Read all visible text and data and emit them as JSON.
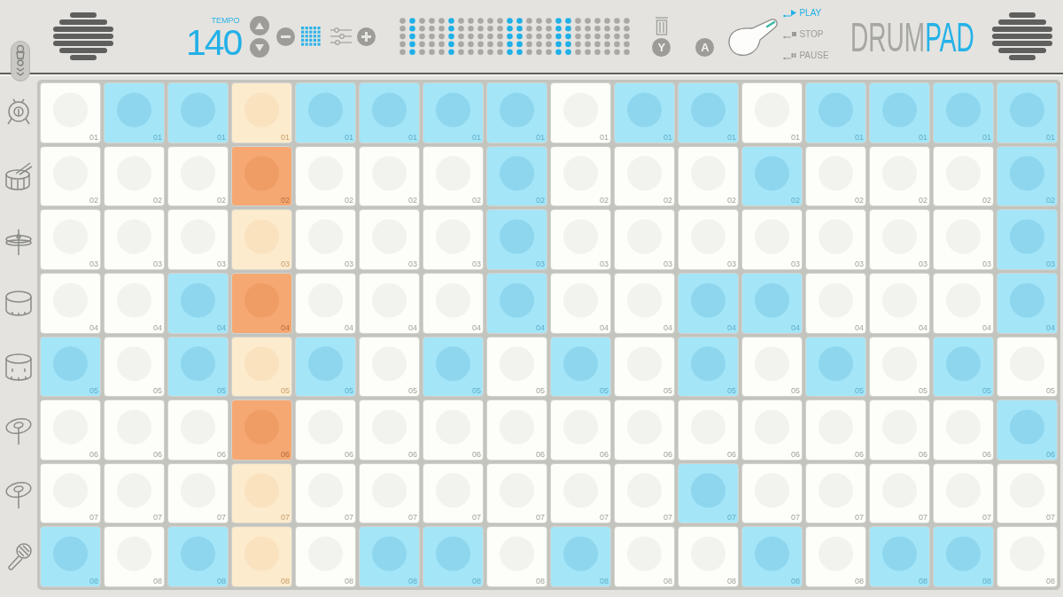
{
  "header": {
    "tempo": {
      "label": "TEMPO",
      "value": "140"
    },
    "key_hints": [
      {
        "kind": "trash",
        "key": "Y"
      },
      {
        "kind": "plain",
        "key": "A"
      }
    ],
    "transport": [
      {
        "kind": "play",
        "label": "PLAY",
        "selected": true
      },
      {
        "kind": "stop",
        "label": "STOP",
        "selected": false
      },
      {
        "kind": "pause",
        "label": "PAUSE",
        "selected": false
      }
    ],
    "logo": {
      "text": "DRUM",
      "accent": "PAD"
    }
  },
  "pattern": {
    "columns": [
      {
        "playing": false
      },
      {
        "playing": false
      },
      {
        "playing": false
      },
      {
        "playing": true
      },
      {
        "playing": false
      },
      {
        "playing": false
      },
      {
        "playing": false
      },
      {
        "playing": false
      },
      {
        "playing": false
      },
      {
        "playing": false
      },
      {
        "playing": false
      },
      {
        "playing": false
      },
      {
        "playing": false
      },
      {
        "playing": false
      },
      {
        "playing": false
      },
      {
        "playing": false
      }
    ],
    "tracks": [
      {
        "steps": [
          {
            "label": "01",
            "on": false
          },
          {
            "label": "01",
            "on": true
          },
          {
            "label": "01",
            "on": true
          },
          {
            "label": "01",
            "on": false
          },
          {
            "label": "01",
            "on": true
          },
          {
            "label": "01",
            "on": true
          },
          {
            "label": "01",
            "on": true
          },
          {
            "label": "01",
            "on": true
          },
          {
            "label": "01",
            "on": false
          },
          {
            "label": "01",
            "on": true
          },
          {
            "label": "01",
            "on": true
          },
          {
            "label": "01",
            "on": false
          },
          {
            "label": "01",
            "on": true
          },
          {
            "label": "01",
            "on": true
          },
          {
            "label": "01",
            "on": true
          },
          {
            "label": "01",
            "on": true
          }
        ]
      },
      {
        "steps": [
          {
            "label": "02",
            "on": false
          },
          {
            "label": "02",
            "on": false
          },
          {
            "label": "02",
            "on": false
          },
          {
            "label": "02",
            "on": true
          },
          {
            "label": "02",
            "on": false
          },
          {
            "label": "02",
            "on": false
          },
          {
            "label": "02",
            "on": false
          },
          {
            "label": "02",
            "on": true
          },
          {
            "label": "02",
            "on": false
          },
          {
            "label": "02",
            "on": false
          },
          {
            "label": "02",
            "on": false
          },
          {
            "label": "02",
            "on": true
          },
          {
            "label": "02",
            "on": false
          },
          {
            "label": "02",
            "on": false
          },
          {
            "label": "02",
            "on": false
          },
          {
            "label": "02",
            "on": true
          }
        ]
      },
      {
        "steps": [
          {
            "label": "03",
            "on": false
          },
          {
            "label": "03",
            "on": false
          },
          {
            "label": "03",
            "on": false
          },
          {
            "label": "03",
            "on": false
          },
          {
            "label": "03",
            "on": false
          },
          {
            "label": "03",
            "on": false
          },
          {
            "label": "03",
            "on": false
          },
          {
            "label": "03",
            "on": true
          },
          {
            "label": "03",
            "on": false
          },
          {
            "label": "03",
            "on": false
          },
          {
            "label": "03",
            "on": false
          },
          {
            "label": "03",
            "on": false
          },
          {
            "label": "03",
            "on": false
          },
          {
            "label": "03",
            "on": false
          },
          {
            "label": "03",
            "on": false
          },
          {
            "label": "03",
            "on": true
          }
        ]
      },
      {
        "steps": [
          {
            "label": "04",
            "on": false
          },
          {
            "label": "04",
            "on": false
          },
          {
            "label": "04",
            "on": true
          },
          {
            "label": "04",
            "on": true
          },
          {
            "label": "04",
            "on": false
          },
          {
            "label": "04",
            "on": false
          },
          {
            "label": "04",
            "on": false
          },
          {
            "label": "04",
            "on": true
          },
          {
            "label": "04",
            "on": false
          },
          {
            "label": "04",
            "on": false
          },
          {
            "label": "04",
            "on": true
          },
          {
            "label": "04",
            "on": true
          },
          {
            "label": "04",
            "on": false
          },
          {
            "label": "04",
            "on": false
          },
          {
            "label": "04",
            "on": false
          },
          {
            "label": "04",
            "on": true
          }
        ]
      },
      {
        "steps": [
          {
            "label": "05",
            "on": true
          },
          {
            "label": "05",
            "on": false
          },
          {
            "label": "05",
            "on": true
          },
          {
            "label": "05",
            "on": false
          },
          {
            "label": "05",
            "on": true
          },
          {
            "label": "05",
            "on": false
          },
          {
            "label": "05",
            "on": true
          },
          {
            "label": "05",
            "on": false
          },
          {
            "label": "05",
            "on": true
          },
          {
            "label": "05",
            "on": false
          },
          {
            "label": "05",
            "on": true
          },
          {
            "label": "05",
            "on": false
          },
          {
            "label": "05",
            "on": true
          },
          {
            "label": "05",
            "on": false
          },
          {
            "label": "05",
            "on": true
          },
          {
            "label": "05",
            "on": false
          }
        ]
      },
      {
        "steps": [
          {
            "label": "06",
            "on": false
          },
          {
            "label": "06",
            "on": false
          },
          {
            "label": "06",
            "on": false
          },
          {
            "label": "06",
            "on": true
          },
          {
            "label": "06",
            "on": false
          },
          {
            "label": "06",
            "on": false
          },
          {
            "label": "06",
            "on": false
          },
          {
            "label": "06",
            "on": false
          },
          {
            "label": "06",
            "on": false
          },
          {
            "label": "06",
            "on": false
          },
          {
            "label": "06",
            "on": false
          },
          {
            "label": "06",
            "on": false
          },
          {
            "label": "06",
            "on": false
          },
          {
            "label": "06",
            "on": false
          },
          {
            "label": "06",
            "on": false
          },
          {
            "label": "06",
            "on": true
          }
        ]
      },
      {
        "steps": [
          {
            "label": "07",
            "on": false
          },
          {
            "label": "07",
            "on": false
          },
          {
            "label": "07",
            "on": false
          },
          {
            "label": "07",
            "on": false
          },
          {
            "label": "07",
            "on": false
          },
          {
            "label": "07",
            "on": false
          },
          {
            "label": "07",
            "on": false
          },
          {
            "label": "07",
            "on": false
          },
          {
            "label": "07",
            "on": false
          },
          {
            "label": "07",
            "on": false
          },
          {
            "label": "07",
            "on": true
          },
          {
            "label": "07",
            "on": false
          },
          {
            "label": "07",
            "on": false
          },
          {
            "label": "07",
            "on": false
          },
          {
            "label": "07",
            "on": false
          },
          {
            "label": "07",
            "on": false
          }
        ]
      },
      {
        "steps": [
          {
            "label": "08",
            "on": true
          },
          {
            "label": "08",
            "on": false
          },
          {
            "label": "08",
            "on": true
          },
          {
            "label": "08",
            "on": false
          },
          {
            "label": "08",
            "on": false
          },
          {
            "label": "08",
            "on": true
          },
          {
            "label": "08",
            "on": true
          },
          {
            "label": "08",
            "on": false
          },
          {
            "label": "08",
            "on": true
          },
          {
            "label": "08",
            "on": false
          },
          {
            "label": "08",
            "on": false
          },
          {
            "label": "08",
            "on": true
          },
          {
            "label": "08",
            "on": false
          },
          {
            "label": "08",
            "on": true
          },
          {
            "label": "08",
            "on": true
          },
          {
            "label": "08",
            "on": false
          }
        ]
      }
    ]
  }
}
